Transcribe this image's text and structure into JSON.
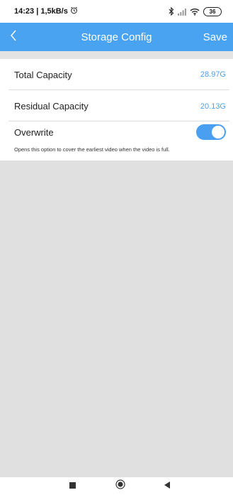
{
  "status_bar": {
    "time_speed": "14:23 | 1,5kB/s",
    "battery": "36"
  },
  "header": {
    "title": "Storage Config",
    "save_label": "Save"
  },
  "settings": {
    "total_capacity": {
      "label": "Total Capacity",
      "value": "28.97G"
    },
    "residual_capacity": {
      "label": "Residual Capacity",
      "value": "20.13G"
    },
    "overwrite": {
      "label": "Overwrite",
      "enabled": true,
      "hint": "Opens this option to cover the earliest video when the video is full."
    }
  },
  "colors": {
    "accent": "#4aa3f0",
    "value_text": "#4a9ff0",
    "background_gray": "#e0e0e0"
  },
  "icons": {
    "back": "chevron-left-icon",
    "alarm": "alarm-icon",
    "bluetooth": "bluetooth-icon",
    "signal": "signal-icon",
    "wifi": "wifi-icon",
    "nav_recent": "square-icon",
    "nav_home": "circle-icon",
    "nav_back": "triangle-icon"
  }
}
